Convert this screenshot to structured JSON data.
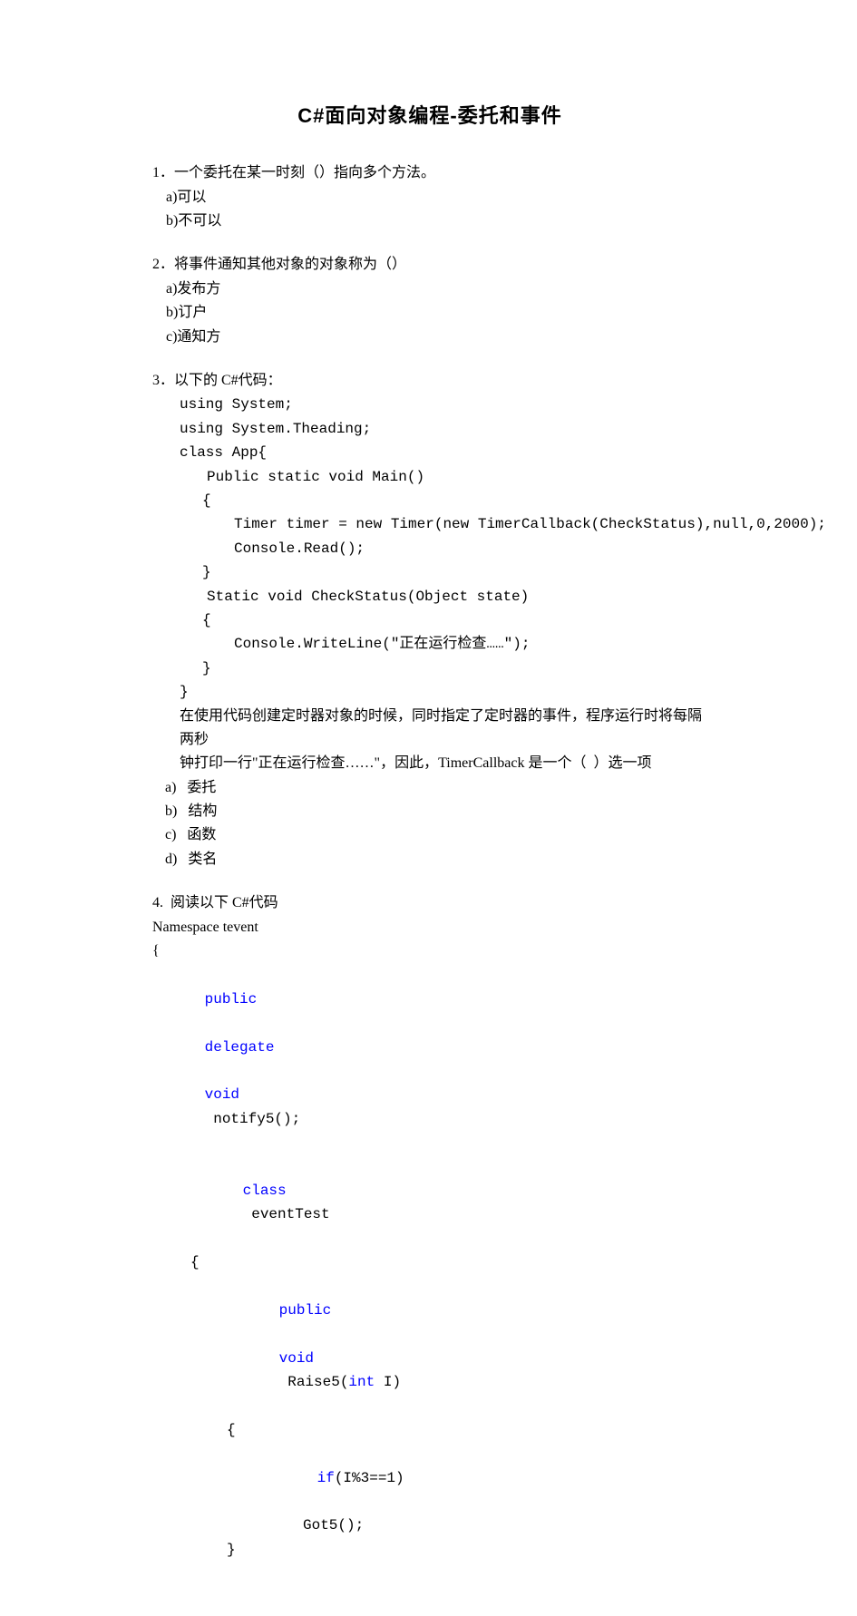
{
  "title": "C#面向对象编程-委托和事件",
  "q1": {
    "stem": "1．一个委托在某一时刻（）指向多个方法。",
    "a": "a)可以",
    "b": "b)不可以"
  },
  "q2": {
    "stem": "2．将事件通知其他对象的对象称为（）",
    "a": "a)发布方",
    "b": "b)订户",
    "c": "c)通知方"
  },
  "q3": {
    "stem": "3．以下的 C#代码：",
    "c1": "using System;",
    "c2": "using System.Theading;",
    "c3": "class App{",
    "c4": "Public static void Main()",
    "c5": "{",
    "c6": "Timer timer = new Timer(new TimerCallback(CheckStatus),null,0,2000);",
    "c7": "Console.Read();",
    "c8": "}",
    "c9": "Static void CheckStatus(Object state)",
    "c10": "{",
    "c11": "Console.WriteLine(\"正在运行检查……\");",
    "c12": "}",
    "c13": "}",
    "desc1": "在使用代码创建定时器对象的时候，同时指定了定时器的事件，程序运行时将每隔两秒",
    "desc2": "钟打印一行\"正在运行检查……\"，因此，TimerCallback 是一个（  ）选一项",
    "a": "a)   委托",
    "b": "b)   结构",
    "c": "c)   函数",
    "d": "d)   类名"
  },
  "q4": {
    "stem": "4.  阅读以下 C#代码",
    "l1": "Namespace tevent",
    "l2": "{",
    "kw_pub1": "public",
    "kw_delegate": "delegate",
    "kw_void1": "void",
    "fn_notify": " notify5();",
    "kw_class": "class",
    "cls_name": " eventTest",
    "brace_open1": "{",
    "kw_pub2": "public",
    "kw_void2": "void",
    "fn_raise": " Raise5(",
    "kw_int": "int",
    "fn_raise_end": " I)",
    "brace_open2": "{",
    "kw_if": "if",
    "cond": "(I%3==1)",
    "got5": "Got5();",
    "brace_close1": "}"
  }
}
